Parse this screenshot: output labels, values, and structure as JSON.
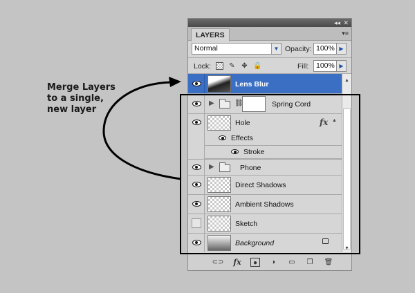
{
  "annotation": {
    "lines": [
      "Merge Layers",
      "to a single,",
      "new layer"
    ]
  },
  "panel": {
    "tab_label": "LAYERS",
    "title_controls": {
      "collapse": "◂◂",
      "close": "✕"
    },
    "menu_glyph": "▾≡",
    "blend_mode": "Normal",
    "opacity_label": "Opacity:",
    "opacity_value": "100%",
    "lock_label": "Lock:",
    "fill_label": "Fill:",
    "fill_value": "100%"
  },
  "layers": [
    {
      "id": "lens-blur",
      "name": "Lens Blur",
      "visible": true,
      "selected": true
    },
    {
      "id": "spring-cord",
      "name": "Spring Cord",
      "visible": true,
      "type": "group-masked"
    },
    {
      "id": "hole",
      "name": "Hole",
      "visible": true,
      "fx_label": "fx"
    },
    {
      "id": "effects",
      "name": "Effects",
      "visible": true
    },
    {
      "id": "stroke",
      "name": "Stroke",
      "visible": true
    },
    {
      "id": "phone",
      "name": "Phone",
      "visible": true,
      "type": "group"
    },
    {
      "id": "direct-shadows",
      "name": "Direct Shadows",
      "visible": true
    },
    {
      "id": "ambient-shadows",
      "name": "Ambient Shadows",
      "visible": true
    },
    {
      "id": "sketch",
      "name": "Sketch",
      "visible": false
    },
    {
      "id": "background",
      "name": "Background",
      "visible": true,
      "locked": true
    }
  ],
  "bottom_icons": [
    "link-icon",
    "fx-icon",
    "mask-icon",
    "adjustment-icon",
    "group-icon",
    "new-layer-icon",
    "trash-icon"
  ],
  "bottom_fx": "fx",
  "colors": {
    "selection": "#3b6fc4",
    "panel_bg": "#d6d6d6",
    "page_bg": "#c4c4c4"
  }
}
